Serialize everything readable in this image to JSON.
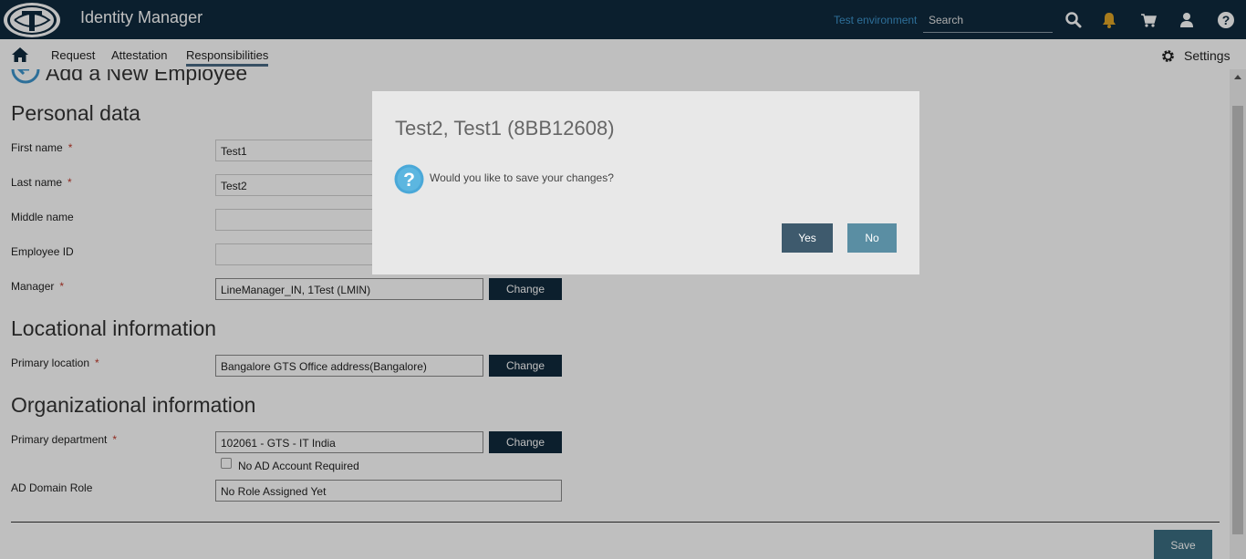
{
  "header": {
    "app_title": "Identity Manager",
    "environment": "Test environment",
    "search_placeholder": "Search",
    "icons": [
      "search-icon",
      "bell-icon",
      "cart-icon",
      "user-icon",
      "help-icon"
    ],
    "colors": {
      "background": "#0f2a3e",
      "environment": "#3d94cc",
      "bell": "#e0a526"
    }
  },
  "nav": {
    "items": [
      {
        "label": "Request"
      },
      {
        "label": "Attestation"
      },
      {
        "label": "Responsibilities",
        "active": true
      }
    ],
    "settings_label": "Settings"
  },
  "page": {
    "title": "Add a New Employee",
    "sections": {
      "personal": "Personal data",
      "locational": "Locational information",
      "organizational": "Organizational information"
    },
    "required_marker": "*",
    "fields": {
      "first_name": {
        "label": "First name",
        "value": "Test1",
        "required": true
      },
      "last_name": {
        "label": "Last name",
        "value": "Test2",
        "required": true
      },
      "middle_name": {
        "label": "Middle name",
        "value": ""
      },
      "employee_id": {
        "label": "Employee ID",
        "value": ""
      },
      "manager": {
        "label": "Manager",
        "value": "LineManager_IN, 1Test (LMIN)",
        "required": true
      },
      "primary_location": {
        "label": "Primary location",
        "value": "Bangalore GTS Office address(Bangalore)",
        "required": true
      },
      "primary_department": {
        "label": "Primary department",
        "value": "102061 - GTS - IT India",
        "required": true
      },
      "no_ad_account": {
        "label": "No AD Account Required",
        "checked": false
      },
      "ad_domain_role": {
        "label": "AD Domain Role",
        "value": "No Role Assigned Yet"
      }
    },
    "change_label": "Change",
    "save_label": "Save"
  },
  "dialog": {
    "title": "Test2, Test1 (8BB12608)",
    "message": "Would you like to save your changes?",
    "yes_label": "Yes",
    "no_label": "No",
    "icon": "question-icon"
  }
}
